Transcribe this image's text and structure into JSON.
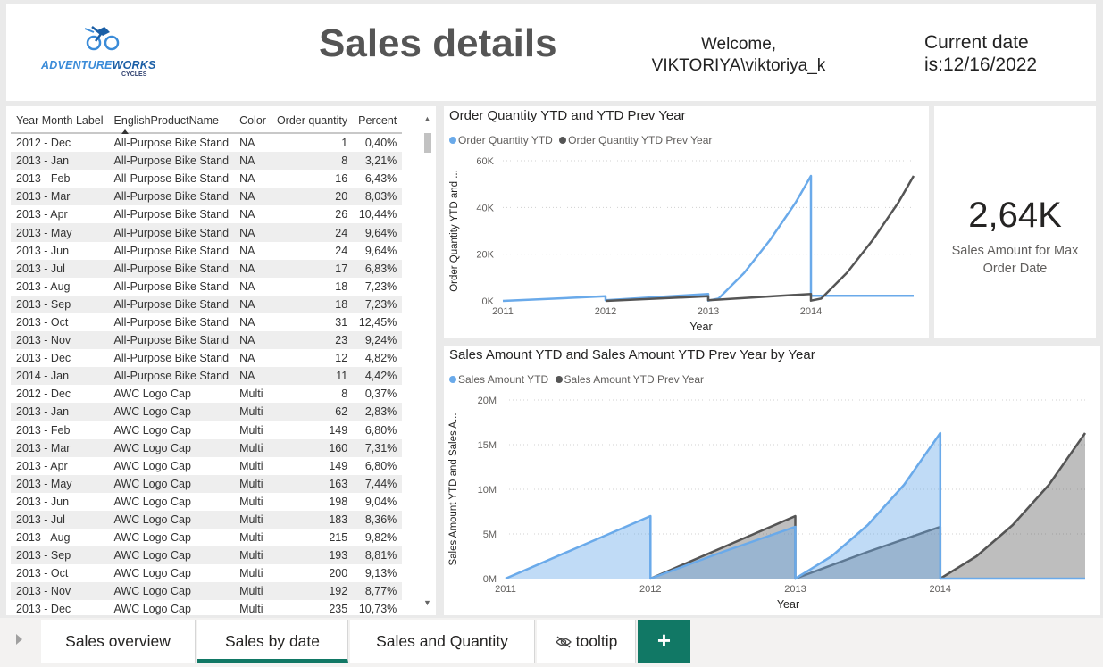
{
  "header": {
    "logo_brand_a": "ADVENTURE",
    "logo_brand_b": "WORKS",
    "logo_sub": "CYCLES",
    "title": "Sales details",
    "welcome_line1": "Welcome,",
    "welcome_line2": "VIKTORIYA\\viktoriya_k",
    "date_line1": "Current date",
    "date_line2": "is:12/16/2022"
  },
  "table": {
    "columns": [
      "Year Month Label",
      "EnglishProductName",
      "Color",
      "Order quantity",
      "Percent"
    ],
    "sorted_column": "EnglishProductName",
    "rows": [
      [
        "2012 - Dec",
        "All-Purpose Bike Stand",
        "NA",
        "1",
        "0,40%"
      ],
      [
        "2013 - Jan",
        "All-Purpose Bike Stand",
        "NA",
        "8",
        "3,21%"
      ],
      [
        "2013 - Feb",
        "All-Purpose Bike Stand",
        "NA",
        "16",
        "6,43%"
      ],
      [
        "2013 - Mar",
        "All-Purpose Bike Stand",
        "NA",
        "20",
        "8,03%"
      ],
      [
        "2013 - Apr",
        "All-Purpose Bike Stand",
        "NA",
        "26",
        "10,44%"
      ],
      [
        "2013 - May",
        "All-Purpose Bike Stand",
        "NA",
        "24",
        "9,64%"
      ],
      [
        "2013 - Jun",
        "All-Purpose Bike Stand",
        "NA",
        "24",
        "9,64%"
      ],
      [
        "2013 - Jul",
        "All-Purpose Bike Stand",
        "NA",
        "17",
        "6,83%"
      ],
      [
        "2013 - Aug",
        "All-Purpose Bike Stand",
        "NA",
        "18",
        "7,23%"
      ],
      [
        "2013 - Sep",
        "All-Purpose Bike Stand",
        "NA",
        "18",
        "7,23%"
      ],
      [
        "2013 - Oct",
        "All-Purpose Bike Stand",
        "NA",
        "31",
        "12,45%"
      ],
      [
        "2013 - Nov",
        "All-Purpose Bike Stand",
        "NA",
        "23",
        "9,24%"
      ],
      [
        "2013 - Dec",
        "All-Purpose Bike Stand",
        "NA",
        "12",
        "4,82%"
      ],
      [
        "2014 - Jan",
        "All-Purpose Bike Stand",
        "NA",
        "11",
        "4,42%"
      ],
      [
        "2012 - Dec",
        "AWC Logo Cap",
        "Multi",
        "8",
        "0,37%"
      ],
      [
        "2013 - Jan",
        "AWC Logo Cap",
        "Multi",
        "62",
        "2,83%"
      ],
      [
        "2013 - Feb",
        "AWC Logo Cap",
        "Multi",
        "149",
        "6,80%"
      ],
      [
        "2013 - Mar",
        "AWC Logo Cap",
        "Multi",
        "160",
        "7,31%"
      ],
      [
        "2013 - Apr",
        "AWC Logo Cap",
        "Multi",
        "149",
        "6,80%"
      ],
      [
        "2013 - May",
        "AWC Logo Cap",
        "Multi",
        "163",
        "7,44%"
      ],
      [
        "2013 - Jun",
        "AWC Logo Cap",
        "Multi",
        "198",
        "9,04%"
      ],
      [
        "2013 - Jul",
        "AWC Logo Cap",
        "Multi",
        "183",
        "8,36%"
      ],
      [
        "2013 - Aug",
        "AWC Logo Cap",
        "Multi",
        "215",
        "9,82%"
      ],
      [
        "2013 - Sep",
        "AWC Logo Cap",
        "Multi",
        "193",
        "8,81%"
      ],
      [
        "2013 - Oct",
        "AWC Logo Cap",
        "Multi",
        "200",
        "9,13%"
      ],
      [
        "2013 - Nov",
        "AWC Logo Cap",
        "Multi",
        "192",
        "8,77%"
      ],
      [
        "2013 - Dec",
        "AWC Logo Cap",
        "Multi",
        "235",
        "10,73%"
      ]
    ]
  },
  "kpi": {
    "value": "2,64K",
    "label": "Sales Amount for Max Order Date"
  },
  "tabs": [
    {
      "label": "Sales overview",
      "active": false
    },
    {
      "label": "Sales by date",
      "active": true
    },
    {
      "label": "Sales and Quantity",
      "active": false
    },
    {
      "label": "tooltip",
      "active": false,
      "hidden": true
    }
  ],
  "add_tab_label": "+",
  "colors": {
    "series_current": "#6aaaea",
    "series_prev": "#555555",
    "accent": "#117865"
  },
  "chart_data": [
    {
      "type": "line",
      "title": "Order Quantity YTD and YTD Prev Year",
      "xlabel": "Year",
      "ylabel": "Order Quantity YTD and ...",
      "x_ticks": [
        "2011",
        "2012",
        "2013",
        "2014"
      ],
      "y_ticks": [
        "0K",
        "20K",
        "40K",
        "60K"
      ],
      "ylim": [
        0,
        60000
      ],
      "xlim": [
        2011,
        2015
      ],
      "grid": true,
      "legend": "top-left",
      "series": [
        {
          "name": "Order Quantity YTD",
          "points": [
            [
              2011,
              0
            ],
            [
              2012,
              2000
            ],
            [
              2012,
              300
            ],
            [
              2013,
              3000
            ],
            [
              2013,
              100
            ],
            [
              2013.1,
              1000
            ],
            [
              2013.35,
              12000
            ],
            [
              2013.6,
              26000
            ],
            [
              2013.85,
              42000
            ],
            [
              2014,
              53500
            ],
            [
              2014,
              2200
            ],
            [
              2015,
              2200
            ]
          ]
        },
        {
          "name": "Order Quantity YTD Prev Year",
          "points": [
            [
              2012,
              0
            ],
            [
              2013,
              2000
            ],
            [
              2013,
              300
            ],
            [
              2014,
              3000
            ],
            [
              2014,
              100
            ],
            [
              2014.1,
              1000
            ],
            [
              2014.35,
              12000
            ],
            [
              2014.6,
              26000
            ],
            [
              2014.85,
              42000
            ],
            [
              2015,
              53500
            ]
          ]
        }
      ]
    },
    {
      "type": "area",
      "title": "Sales Amount YTD and Sales Amount YTD Prev Year by Year",
      "xlabel": "Year",
      "ylabel": "Sales Amount YTD and Sales A...",
      "x_ticks": [
        "2011",
        "2012",
        "2013",
        "2014"
      ],
      "y_ticks": [
        "0M",
        "5M",
        "10M",
        "15M",
        "20M"
      ],
      "ylim": [
        0,
        20000000
      ],
      "xlim": [
        2011,
        2015
      ],
      "grid": true,
      "legend": "top-left",
      "series": [
        {
          "name": "Sales Amount YTD",
          "points": [
            [
              2011,
              0
            ],
            [
              2011.5,
              3500000
            ],
            [
              2012,
              7000000
            ],
            [
              2012,
              0
            ],
            [
              2012.5,
              3000000
            ],
            [
              2013,
              5800000
            ],
            [
              2013,
              0
            ],
            [
              2013.25,
              2500000
            ],
            [
              2013.5,
              6000000
            ],
            [
              2013.75,
              10500000
            ],
            [
              2014,
              16300000
            ],
            [
              2014,
              0
            ],
            [
              2015,
              0
            ]
          ]
        },
        {
          "name": "Sales Amount YTD Prev Year",
          "points": [
            [
              2012,
              0
            ],
            [
              2012.5,
              3500000
            ],
            [
              2013,
              7000000
            ],
            [
              2013,
              0
            ],
            [
              2013.5,
              3000000
            ],
            [
              2014,
              5800000
            ],
            [
              2014,
              0
            ],
            [
              2014.25,
              2500000
            ],
            [
              2014.5,
              6000000
            ],
            [
              2014.75,
              10500000
            ],
            [
              2015,
              16300000
            ]
          ]
        }
      ]
    }
  ]
}
